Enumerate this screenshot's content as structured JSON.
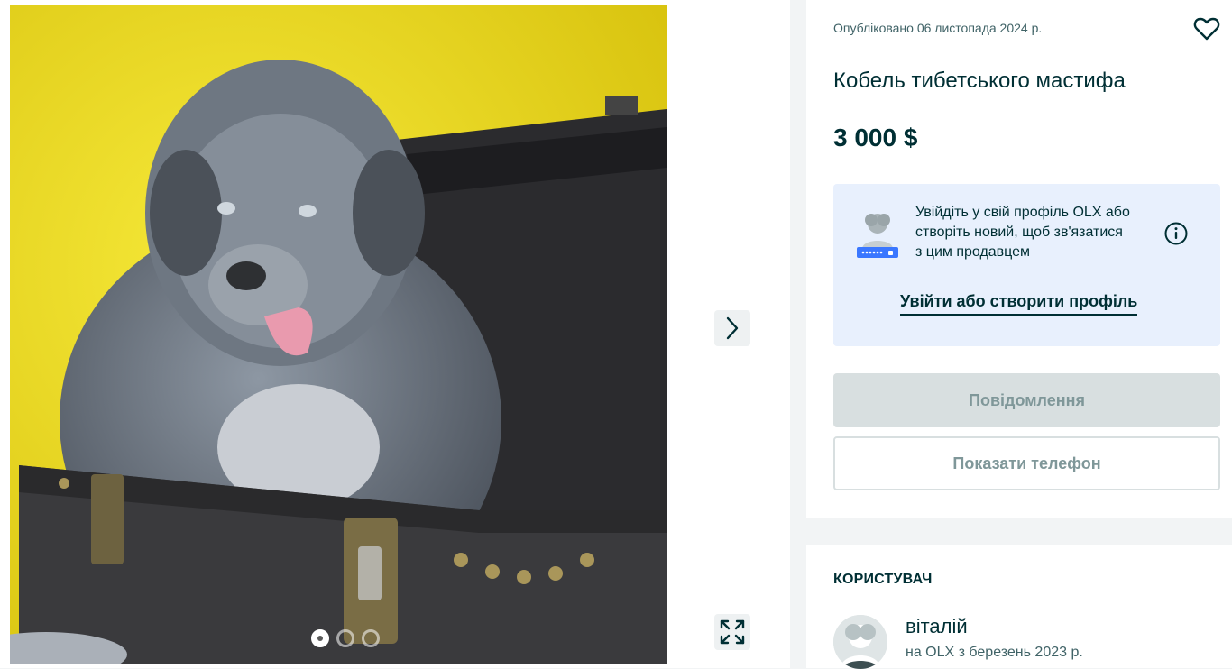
{
  "gallery": {
    "photo_alt": "Кобель тибетського мастифа",
    "slides_total": 3,
    "active_slide": 1,
    "next_icon": "chevron-right-icon",
    "expand_icon": "expand-icon"
  },
  "listing": {
    "published": "Опубліковано 06 листопада 2024 р.",
    "title": "Кобель тибетського мастифа",
    "price": "3 000 $",
    "favorite_icon": "heart-icon"
  },
  "login_prompt": {
    "text": "Увійдіть у свій профіль OLX або створіть новий, щоб зв'язатися з цим продавцем",
    "link": "Увійти або створити профіль",
    "info_icon": "info-icon"
  },
  "actions": {
    "message_label": "Повідомлення",
    "phone_label": "Показати телефон"
  },
  "seller": {
    "heading": "КОРИСТУВАЧ",
    "name": "віталій",
    "since": "на OLX з березень 2023 р."
  },
  "colors": {
    "brand_dark": "#002f34",
    "login_bg": "#e8f0fd",
    "photo_bg": "#f4e21b"
  }
}
